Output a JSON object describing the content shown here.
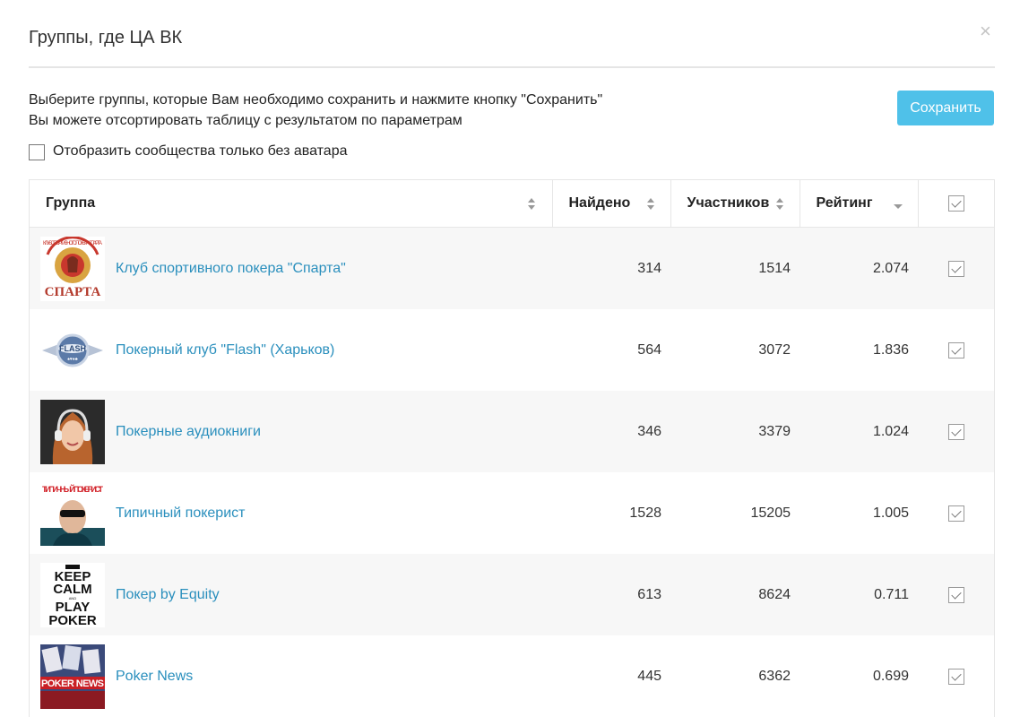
{
  "dialog": {
    "title": "Группы, где ЦА ВК",
    "close_symbol": "×"
  },
  "intro": {
    "line1": "Выберите группы, которые Вам необходимо сохранить и нажмите кнопку \"Сохранить\"",
    "line2": "Вы можете отсортировать таблицу с результатом по параметрам"
  },
  "save_button": {
    "label": "Сохранить"
  },
  "filter": {
    "label": "Отобразить сообщества только без аватара",
    "checked": false
  },
  "colors": {
    "accent": "#4fc1e9",
    "link": "#2a8fbd",
    "row_alt": "#f7f7f7"
  },
  "table": {
    "columns": {
      "group": "Группа",
      "found": "Найдено",
      "members": "Участников",
      "rating": "Рейтинг"
    },
    "rows": [
      {
        "name": "Клуб спортивного покера \"Спарта\"",
        "found": "314",
        "members": "1514",
        "rating": "2.074",
        "avatar": "sparta-logo",
        "avatar_text": "КЛУБ СПОРТИВНОГО ПОКЕРА СПАРТА",
        "checked": true
      },
      {
        "name": "Покерный клуб \"Flash\" (Харьков)",
        "found": "564",
        "members": "3072",
        "rating": "1.836",
        "avatar": "flash-logo",
        "avatar_text": "FLASH",
        "checked": true
      },
      {
        "name": "Покерные аудиокниги",
        "found": "346",
        "members": "3379",
        "rating": "1.024",
        "avatar": "woman-headphones-photo",
        "checked": true
      },
      {
        "name": "Типичный покерист",
        "found": "1528",
        "members": "15205",
        "rating": "1.005",
        "avatar": "typical-poker-player-photo",
        "avatar_text": "ТИПИЧНЫЙ ПОКЕРИСТ",
        "checked": true
      },
      {
        "name": "Покер by Equity",
        "found": "613",
        "members": "8624",
        "rating": "0.711",
        "avatar": "keep-calm-poster",
        "avatar_text": "KEEP CALM AND PLAY POKER",
        "checked": true
      },
      {
        "name": "Poker News",
        "found": "445",
        "members": "6362",
        "rating": "0.699",
        "avatar": "poker-news-logo",
        "avatar_text": "POKER NEWS",
        "checked": true
      }
    ]
  }
}
